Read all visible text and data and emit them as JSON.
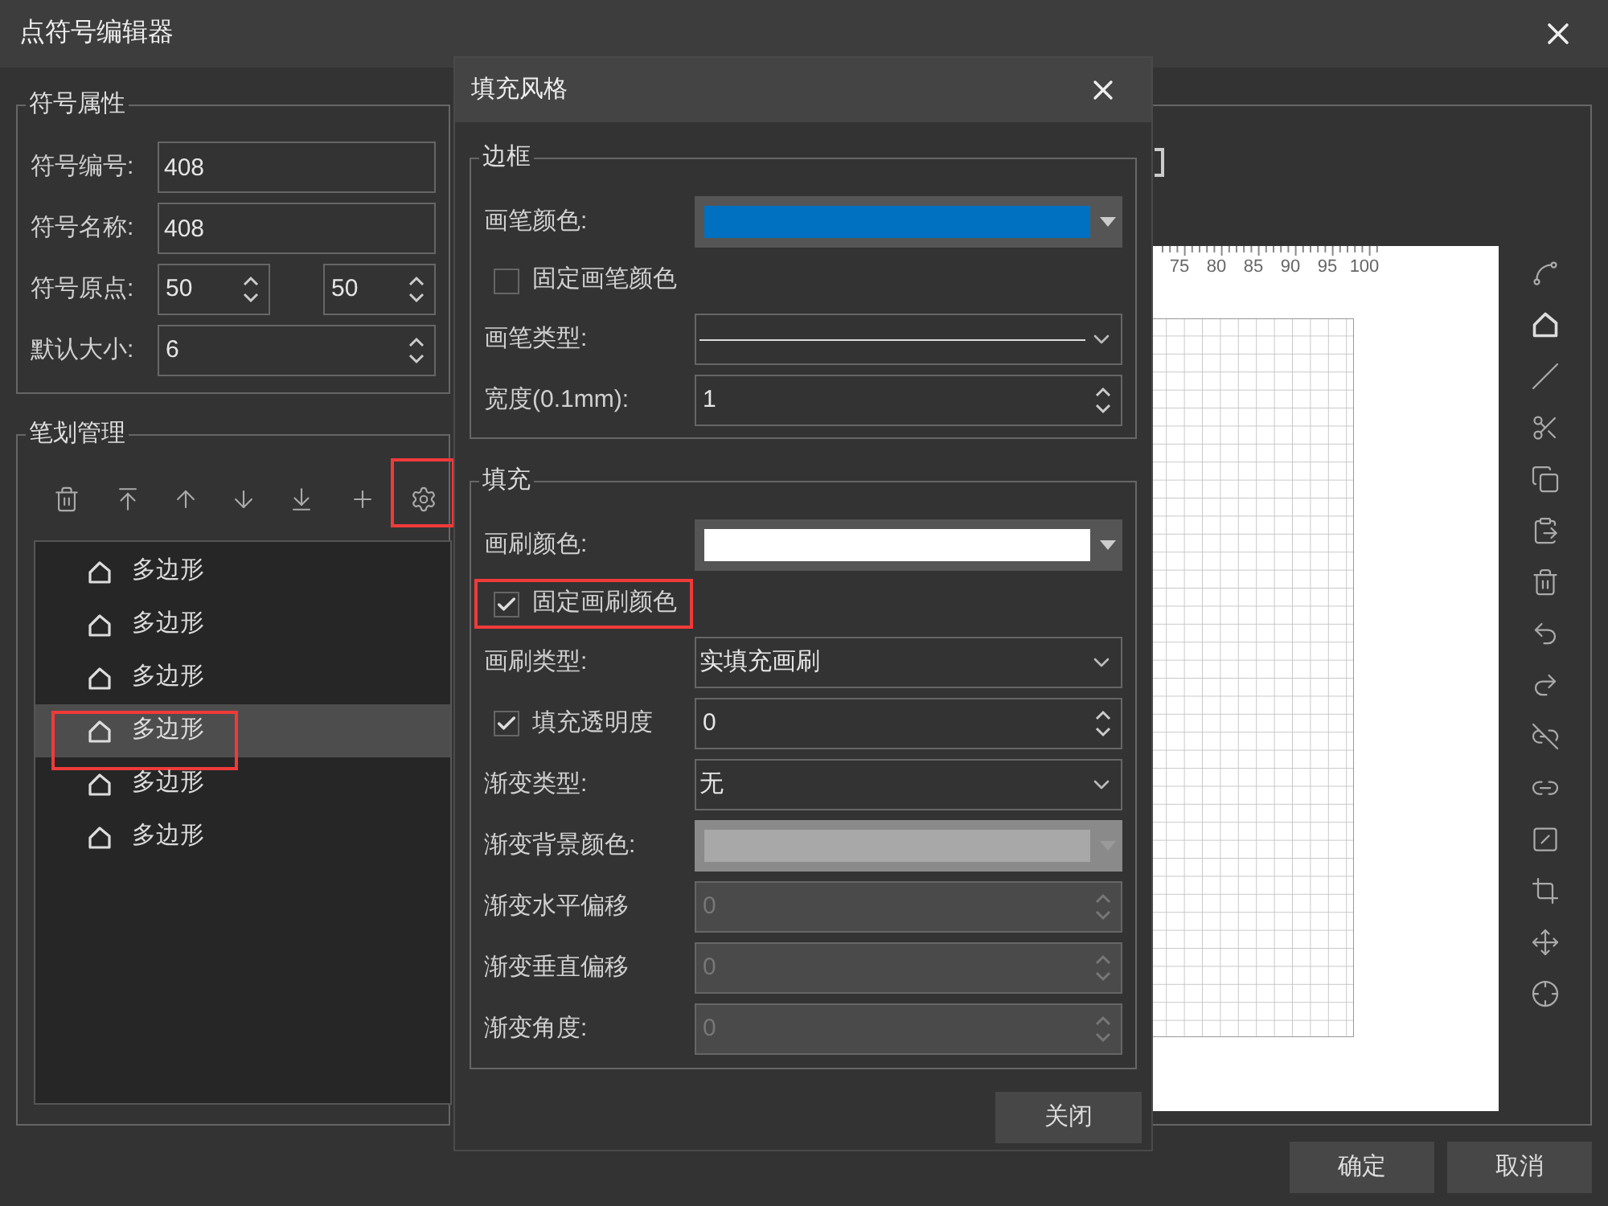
{
  "window": {
    "title": "点符号编辑器"
  },
  "symbol_properties": {
    "title": "符号属性",
    "rows": [
      {
        "kind": "text",
        "label": "符号编号:",
        "value": "408"
      },
      {
        "kind": "text",
        "label": "符号名称:",
        "value": "408"
      },
      {
        "kind": "spin-pair",
        "label": "符号原点:",
        "values": [
          "50",
          "50"
        ]
      },
      {
        "kind": "spin",
        "label": "默认大小:",
        "value": "6"
      }
    ]
  },
  "stroke_management": {
    "title": "笔划管理",
    "settings_highlighted": true,
    "items": [
      {
        "label": "多边形",
        "selected": false,
        "highlighted": false
      },
      {
        "label": "多边形",
        "selected": false,
        "highlighted": false
      },
      {
        "label": "多边形",
        "selected": false,
        "highlighted": false
      },
      {
        "label": "多边形",
        "selected": true,
        "highlighted": true
      },
      {
        "label": "多边形",
        "selected": false,
        "highlighted": false
      },
      {
        "label": "多边形",
        "selected": false,
        "highlighted": false
      }
    ]
  },
  "canvas": {
    "ruler_labels": [
      "75",
      "80",
      "85",
      "90",
      "95",
      "100"
    ]
  },
  "buttons": [
    {
      "label": "确定"
    },
    {
      "label": "取消"
    }
  ],
  "fill_dialog": {
    "title": "填充风格",
    "sections": [
      {
        "title": "边框",
        "rows": [
          {
            "kind": "color",
            "label": "画笔颜色:",
            "color": "#0070c0",
            "disabled": false
          },
          {
            "kind": "checkbox",
            "label": "固定画笔颜色",
            "checked": false,
            "highlighted": false
          },
          {
            "kind": "line-select",
            "label": "画笔类型:"
          },
          {
            "kind": "spin",
            "label": "宽度(0.1mm):",
            "value": "1",
            "disabled": false
          }
        ]
      },
      {
        "title": "填充",
        "rows": [
          {
            "kind": "color",
            "label": "画刷颜色:",
            "color": "#ffffff",
            "disabled": false
          },
          {
            "kind": "checkbox",
            "label": "固定画刷颜色",
            "checked": true,
            "highlighted": true
          },
          {
            "kind": "select",
            "label": "画刷类型:",
            "value": "实填充画刷"
          },
          {
            "kind": "check-spin",
            "label": "填充透明度",
            "checked": true,
            "value": "0"
          },
          {
            "kind": "select",
            "label": "渐变类型:",
            "value": "无"
          },
          {
            "kind": "color",
            "label": "渐变背景颜色:",
            "color": "#a8a8a8",
            "disabled": true
          },
          {
            "kind": "spin",
            "label": "渐变水平偏移",
            "value": "0",
            "disabled": true
          },
          {
            "kind": "spin",
            "label": "渐变垂直偏移",
            "value": "0",
            "disabled": true
          },
          {
            "kind": "spin",
            "label": "渐变角度:",
            "value": "0",
            "disabled": true
          }
        ]
      }
    ],
    "close_button": "关闭"
  }
}
